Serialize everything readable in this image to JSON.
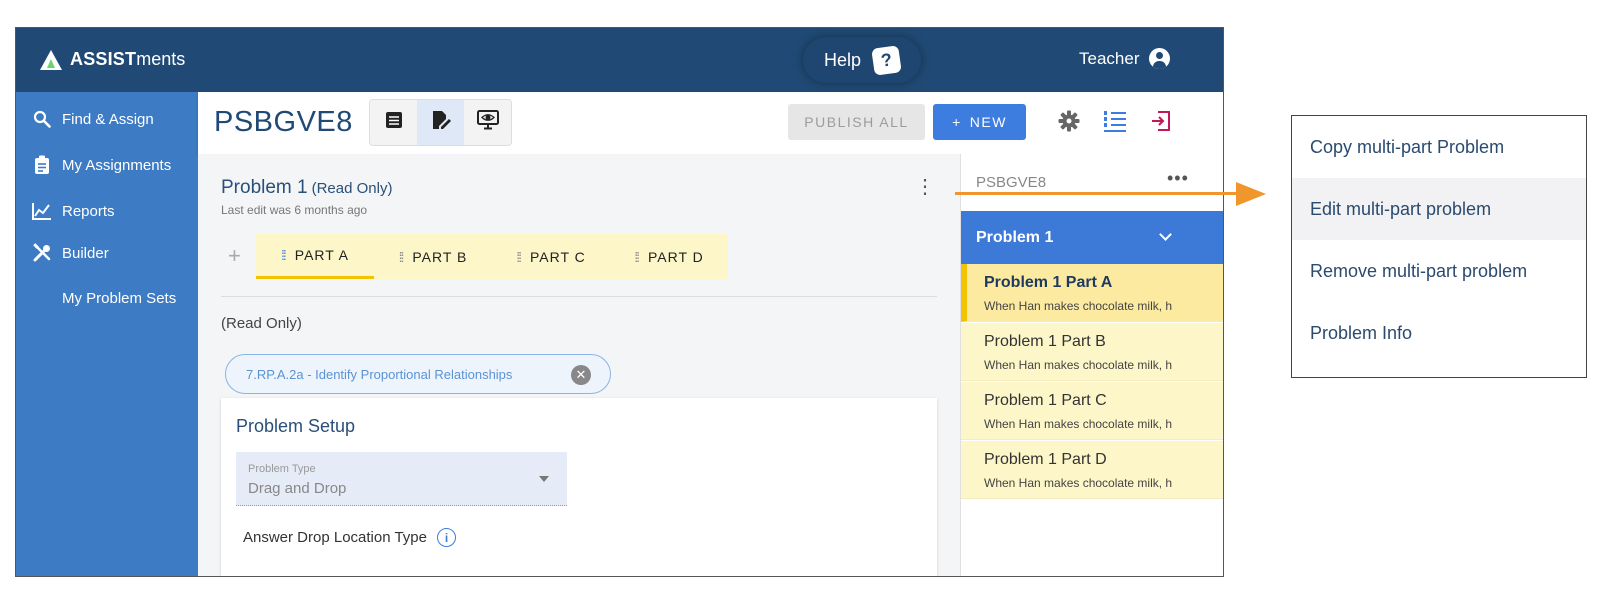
{
  "app": {
    "logo_bold": "ASSIST",
    "logo_light": "ments",
    "help_label": "Help",
    "help_icon": "?",
    "user_label": "Teacher"
  },
  "sidebar": {
    "items": [
      {
        "label": "Find & Assign",
        "icon": "search-icon"
      },
      {
        "label": "My Assignments",
        "icon": "clipboard-icon"
      },
      {
        "label": "Reports",
        "icon": "chart-icon"
      },
      {
        "label": "Builder",
        "icon": "tools-icon"
      }
    ],
    "sub_item": "My Problem Sets"
  },
  "header": {
    "problem_set_id": "PSBGVE8",
    "publish_label": "PUBLISH ALL",
    "new_label": "NEW",
    "new_icon": "+"
  },
  "problem": {
    "title": "Problem 1",
    "read_only_tag": "(Read Only)",
    "last_edit": "Last edit was 6 months ago",
    "parts": [
      "PART A",
      "PART B",
      "PART C",
      "PART D"
    ],
    "active_part": "PART A",
    "read_only_note": "(Read Only)",
    "standard_chip": "7.RP.A.2a - Identify Proportional Relationships",
    "setup_title": "Problem Setup",
    "type_label": "Problem Type",
    "type_value": "Drag and Drop",
    "drop_location_label": "Answer Drop Location Type"
  },
  "right_panel": {
    "title": "PSBGVE8",
    "more_icon": "•••",
    "problem_label": "Problem 1",
    "parts": [
      {
        "title": "Problem 1 Part A",
        "preview": "When Han makes chocolate milk, h"
      },
      {
        "title": "Problem 1 Part B",
        "preview": "When Han makes chocolate milk, h"
      },
      {
        "title": "Problem 1 Part C",
        "preview": "When Han makes chocolate milk, h"
      },
      {
        "title": "Problem 1 Part D",
        "preview": "When Han makes chocolate milk, h"
      }
    ]
  },
  "context_menu": {
    "items": [
      "Copy multi-part Problem",
      "Edit multi-part problem",
      "Remove multi-part problem",
      "Problem Info"
    ],
    "highlighted_index": 1
  },
  "colors": {
    "topbar": "#204a75",
    "sidebar": "#3d7bc4",
    "accent_blue": "#3e7de0",
    "part_highlight": "#fdf6c8",
    "arrow": "#f0962c"
  }
}
